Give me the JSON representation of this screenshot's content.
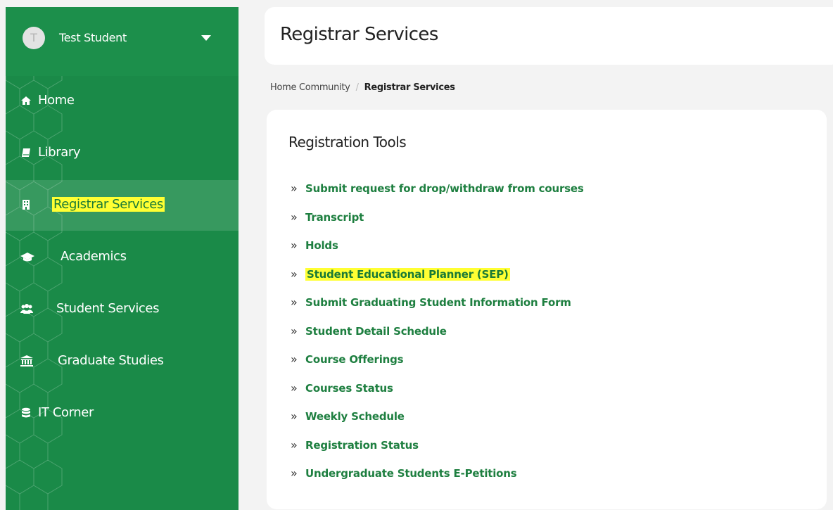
{
  "user": {
    "initial": "T",
    "name": "Test Student"
  },
  "sidebar": {
    "items": [
      {
        "label": "Home"
      },
      {
        "label": "Library"
      },
      {
        "label": "Registrar Services",
        "active": true,
        "highlighted": true
      },
      {
        "label": "Academics"
      },
      {
        "label": "Student Services"
      },
      {
        "label": "Graduate Studies"
      },
      {
        "label": "IT Corner"
      }
    ]
  },
  "header": {
    "title": "Registrar Services"
  },
  "breadcrumb": {
    "home": "Home Community",
    "separator": "/",
    "current": "Registrar Services"
  },
  "card": {
    "title": "Registration Tools",
    "links": [
      "Submit request for drop/withdraw from courses",
      "Transcript",
      "Holds",
      "Student Educational Planner (SEP)",
      "Submit Graduating Student Information Form",
      "Student Detail Schedule",
      "Course Offerings",
      "Courses Status",
      "Weekly Schedule",
      "Registration Status",
      "Undergraduate Students E-Petitions"
    ],
    "highlighted_link": "Student Educational Planner (SEP)"
  },
  "colors": {
    "sidebar": "#1a8a48",
    "link": "#1e7f40",
    "highlight": "#ffff33"
  },
  "icons": [
    "home-icon",
    "book-icon",
    "building-icon",
    "graduation-cap-icon",
    "users-icon",
    "university-icon",
    "database-icon",
    "chevron-double-right-icon",
    "caret-down-icon"
  ]
}
